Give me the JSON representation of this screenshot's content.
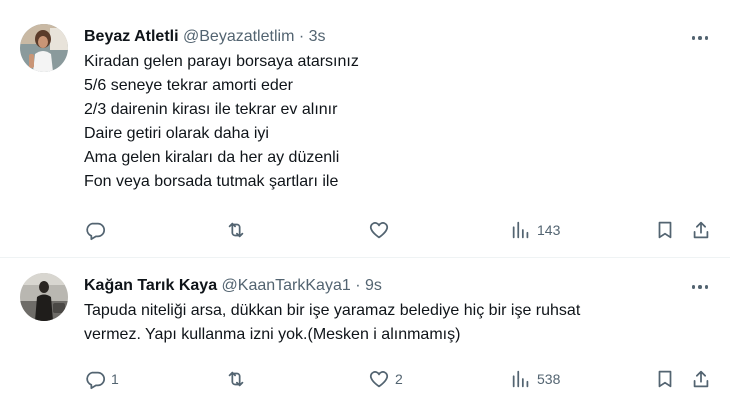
{
  "tweets": [
    {
      "name": "Beyaz Atletli",
      "handle": "@Beyazatletlim",
      "separator": "·",
      "time": "3s",
      "lines": [
        "Kiradan gelen parayı borsaya atarsınız",
        "5/6 seneye tekrar amorti eder",
        "2/3 dairenin kirası ile tekrar ev alınır",
        "Daire getiri olarak daha iyi",
        "Ama gelen kiraları da her ay düzenli",
        "Fon veya borsada tutmak şartları ile"
      ],
      "replies": "",
      "retweets": "",
      "likes": "",
      "views": "143"
    },
    {
      "name": "Kağan Tarık Kaya",
      "handle": "@KaanTarkKaya1",
      "separator": "·",
      "time": "9s",
      "lines": [
        "Tapuda niteliği arsa, dükkan bir işe yaramaz belediye hiç bir işe ruhsat",
        "vermez. Yapı kullanma izni yok.(Mesken i alınmamış)"
      ],
      "replies": "1",
      "retweets": "",
      "likes": "2",
      "views": "538"
    }
  ],
  "icons": [
    "avatar",
    "more-icon",
    "reply-icon",
    "retweet-icon",
    "like-icon",
    "views-icon",
    "bookmark-icon",
    "share-icon"
  ]
}
